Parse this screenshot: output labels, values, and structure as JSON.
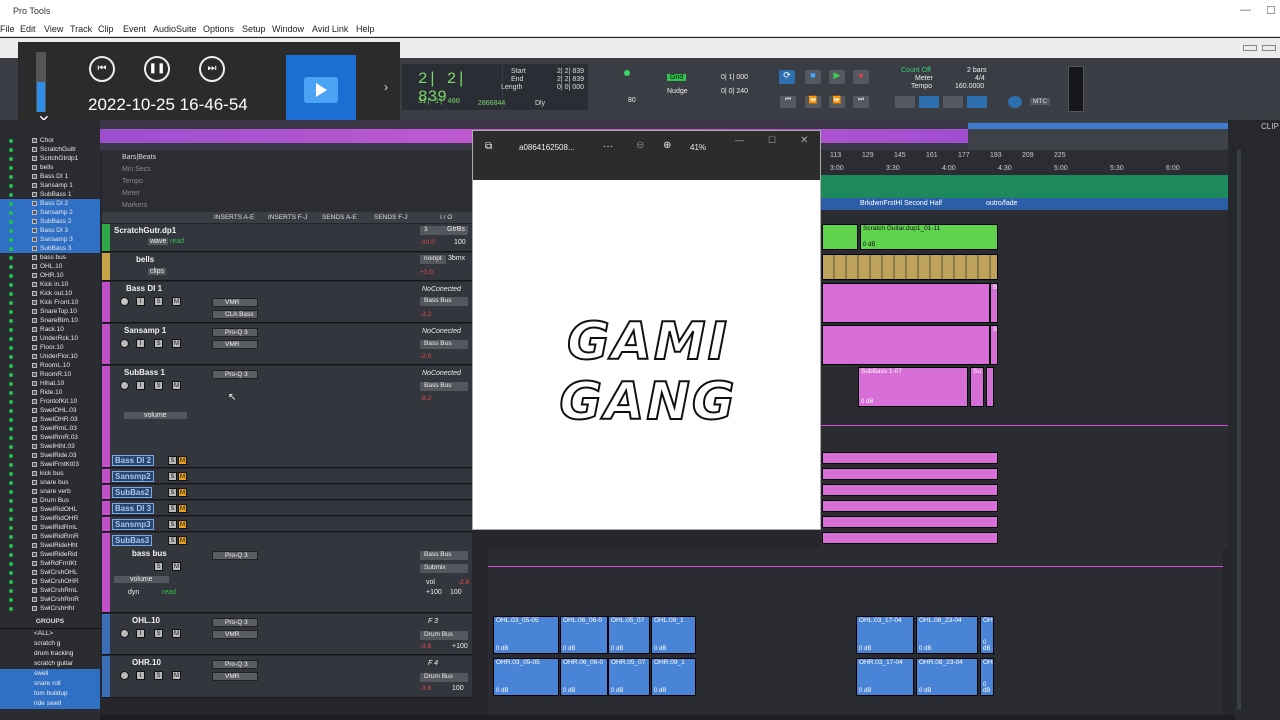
{
  "app": {
    "title": "Pro Tools",
    "menus": [
      "File",
      "Edit",
      "View",
      "Track",
      "Clip",
      "Event",
      "AudioSuite",
      "Options",
      "Setup",
      "Window",
      "Avid Link",
      "Help"
    ]
  },
  "recorder": {
    "timestamp": "2022-10-25 16-46-54",
    "close": "✕",
    "chevron": "›"
  },
  "transport": {
    "main_counter": "2| 2| 839",
    "sub_counter": "31| 1| 400",
    "samples": "2866844",
    "start_label": "Start",
    "end_label": "End",
    "length_label": "Length",
    "start": "2| 2| 839",
    "end": "2| 2| 839",
    "length": "0| 0| 000",
    "dly": "Dly",
    "grid_label": "Grid",
    "grid_val": "0| 1| 000",
    "nudge_label": "Nudge",
    "nudge_val": "0| 0| 240",
    "count_off": "Count Off",
    "count_bars": "2 bars",
    "meter_label": "Meter",
    "meter_val": "4/4",
    "tempo_label": "Tempo",
    "tempo_val": "160.0000",
    "mtc": "MTC",
    "num80": "80"
  },
  "tracklist": {
    "items": [
      {
        "name": "Chor",
        "sel": false
      },
      {
        "name": "ScratchGuitr",
        "sel": false
      },
      {
        "name": "ScrtchGtrdp1",
        "sel": false
      },
      {
        "name": "bells",
        "sel": false
      },
      {
        "name": "Bass DI 1",
        "sel": false
      },
      {
        "name": "Sansamp 1",
        "sel": false
      },
      {
        "name": "SubBass 1",
        "sel": false
      },
      {
        "name": "Bass DI 2",
        "sel": true
      },
      {
        "name": "Sansamp 2",
        "sel": true
      },
      {
        "name": "SubBass 2",
        "sel": true
      },
      {
        "name": "Bass DI 3",
        "sel": true
      },
      {
        "name": "Sansamp 3",
        "sel": true
      },
      {
        "name": "SubBass 3",
        "sel": true
      },
      {
        "name": "bass bus",
        "sel": false
      },
      {
        "name": "OHL.10",
        "sel": false
      },
      {
        "name": "OHR.10",
        "sel": false
      },
      {
        "name": "Kick in.10",
        "sel": false
      },
      {
        "name": "Kick out.10",
        "sel": false
      },
      {
        "name": "Kick Front.10",
        "sel": false
      },
      {
        "name": "SnareTop.10",
        "sel": false
      },
      {
        "name": "SnareBtm.10",
        "sel": false
      },
      {
        "name": "Rack.10",
        "sel": false
      },
      {
        "name": "UnderRck.10",
        "sel": false
      },
      {
        "name": "Floor.10",
        "sel": false
      },
      {
        "name": "UnderFlor.10",
        "sel": false
      },
      {
        "name": "RoomL.10",
        "sel": false
      },
      {
        "name": "RoomR.10",
        "sel": false
      },
      {
        "name": "Hihat.10",
        "sel": false
      },
      {
        "name": "Ride.10",
        "sel": false
      },
      {
        "name": "FrontofKit.10",
        "sel": false
      },
      {
        "name": "SwelOHL.03",
        "sel": false
      },
      {
        "name": "SwelOHR.03",
        "sel": false
      },
      {
        "name": "SwelRmL.03",
        "sel": false
      },
      {
        "name": "SwelRmR.03",
        "sel": false
      },
      {
        "name": "SwelHiht.03",
        "sel": false
      },
      {
        "name": "SwelRide.03",
        "sel": false
      },
      {
        "name": "SwelFrntKt03",
        "sel": false
      },
      {
        "name": "kick bus",
        "sel": false
      },
      {
        "name": "snare bus",
        "sel": false
      },
      {
        "name": "snare verb",
        "sel": false
      },
      {
        "name": "Drum Bus",
        "sel": false
      },
      {
        "name": "SwelRidOHL",
        "sel": false
      },
      {
        "name": "SwelRidOHR",
        "sel": false
      },
      {
        "name": "SwelRidRmL",
        "sel": false
      },
      {
        "name": "SwelRidRmR",
        "sel": false
      },
      {
        "name": "SwelRideHht",
        "sel": false
      },
      {
        "name": "SwelRideRid",
        "sel": false
      },
      {
        "name": "SwlRdFrntKt",
        "sel": false
      },
      {
        "name": "SwlCrshOHL",
        "sel": false
      },
      {
        "name": "SwlCrshOHR",
        "sel": false
      },
      {
        "name": "SwlCrshRmL",
        "sel": false
      },
      {
        "name": "SwlCrshRmR",
        "sel": false
      },
      {
        "name": "SwlCrshHht",
        "sel": false
      }
    ]
  },
  "groups": {
    "title": "GROUPS",
    "items": [
      {
        "name": "<ALL>",
        "sel": false
      },
      {
        "name": "scratch g",
        "sel": false
      },
      {
        "name": "drum tracking",
        "sel": false
      },
      {
        "name": "scratch guitar",
        "sel": false
      },
      {
        "name": "swell",
        "sel": true
      },
      {
        "name": "snare roll",
        "sel": true
      },
      {
        "name": "tom buildup",
        "sel": true
      },
      {
        "name": "ride swell",
        "sel": true
      }
    ]
  },
  "rulers": {
    "bars_beats": "Bars|Beats",
    "min_secs": "Min:Secs",
    "tempo": "Tempo",
    "meter": "Meter",
    "markers": "Markers",
    "bar_ticks": [
      "113",
      "129",
      "145",
      "161",
      "177",
      "193",
      "209",
      "225"
    ],
    "time_ticks": [
      "3:00",
      "3:30",
      "4:00",
      "4:30",
      "5:00",
      "5:30",
      "6:00"
    ],
    "marker_text": "BrkdwnFrstHl  Second Half",
    "marker_end": "outro/fade"
  },
  "columns": {
    "inserts_ae": "INSERTS A-E",
    "inserts_fj": "INSERTS F-J",
    "sends_ae": "SENDS A-E",
    "sends_fj": "SENDS F-J",
    "io": "I / O"
  },
  "tracks": {
    "scratch": {
      "name": "ScratchGutr.dp1",
      "view": "wave",
      "read": "read",
      "io1": "3",
      "io2": "GtrBs",
      "vol": "-10.0",
      "pan": "100"
    },
    "bells": {
      "name": "bells",
      "view": "clips",
      "io1": "noinpt",
      "io2": "3bmx",
      "vol": "+3.0"
    },
    "bass1": {
      "name": "Bass DI 1",
      "ins1": "VMR",
      "ins2": "CLA Bass",
      "io1": "NoConected",
      "io2": "Bass Bus",
      "vol": "-3.2"
    },
    "sansamp1": {
      "name": "Sansamp 1",
      "ins1": "Pro-Q 3",
      "ins2": "VMR",
      "io1": "NoConected",
      "io2": "Bass Bus",
      "vol": "-2.0"
    },
    "subbass1": {
      "name": "SubBass 1",
      "ins1": "Pro-Q 3",
      "io1": "NoConected",
      "io2": "Bass Bus",
      "vol": "-9.2",
      "auto": "volume"
    },
    "small": [
      {
        "name": "Bass DI 2"
      },
      {
        "name": "Sansmp2"
      },
      {
        "name": "SubBas2"
      },
      {
        "name": "Bass DI 3"
      },
      {
        "name": "Sansmp3"
      },
      {
        "name": "SubBas3"
      }
    ],
    "bassbus": {
      "name": "bass bus",
      "ins1": "Pro-Q 3",
      "io1": "Bass Bus",
      "io2": "Submix",
      "auto": "volume",
      "auto2": "dyn",
      "read": "read",
      "vol_label": "vol",
      "vol": "-2.6",
      "pan1": "+100",
      "pan2": "100"
    },
    "ohl": {
      "name": "OHL.10",
      "ins1": "Pro-Q 3",
      "ins2": "VMR",
      "io1": "F 3",
      "io2": "Drum Bus",
      "vol": "-3.9",
      "pan": "+100"
    },
    "ohr": {
      "name": "OHR.10",
      "ins1": "Pro-Q 3",
      "ins2": "VMR",
      "io1": "F 4",
      "io2": "Drum Bus",
      "vol": "-3.9",
      "pan": "100"
    }
  },
  "clips": {
    "scratch_clip": "Scratch Guitar.dup1_01-11",
    "db": "0 dB",
    "subbass_clip": "SubBass 1-07",
    "su": "Su",
    "s": "S",
    "b": "B",
    "ohl": [
      "OHL.03_05-05",
      "OHL.06_06-0",
      "OHL.05_07",
      "OHL.09_1",
      "OHL.03_17-04",
      "OHL.08_23-04",
      "OH"
    ],
    "ohr": [
      "OHR.03_05-05",
      "OHR.06_06-0",
      "OHR.05_07",
      "OHR.09_1",
      "OHR.03_17-04",
      "OHR.08_23-04",
      "OH"
    ]
  },
  "viewer": {
    "filename": "a0864162508...",
    "zoom": "41%",
    "more": "···",
    "image_text": "GAMI GANG"
  },
  "rightpanel": {
    "title": "CLIP"
  },
  "colors": {
    "accent_green": "#30c24d",
    "clip_pink": "#d86fd8",
    "clip_green": "#5fd34e",
    "clip_blue": "#4a84d6",
    "selection": "#2f6fc4"
  }
}
